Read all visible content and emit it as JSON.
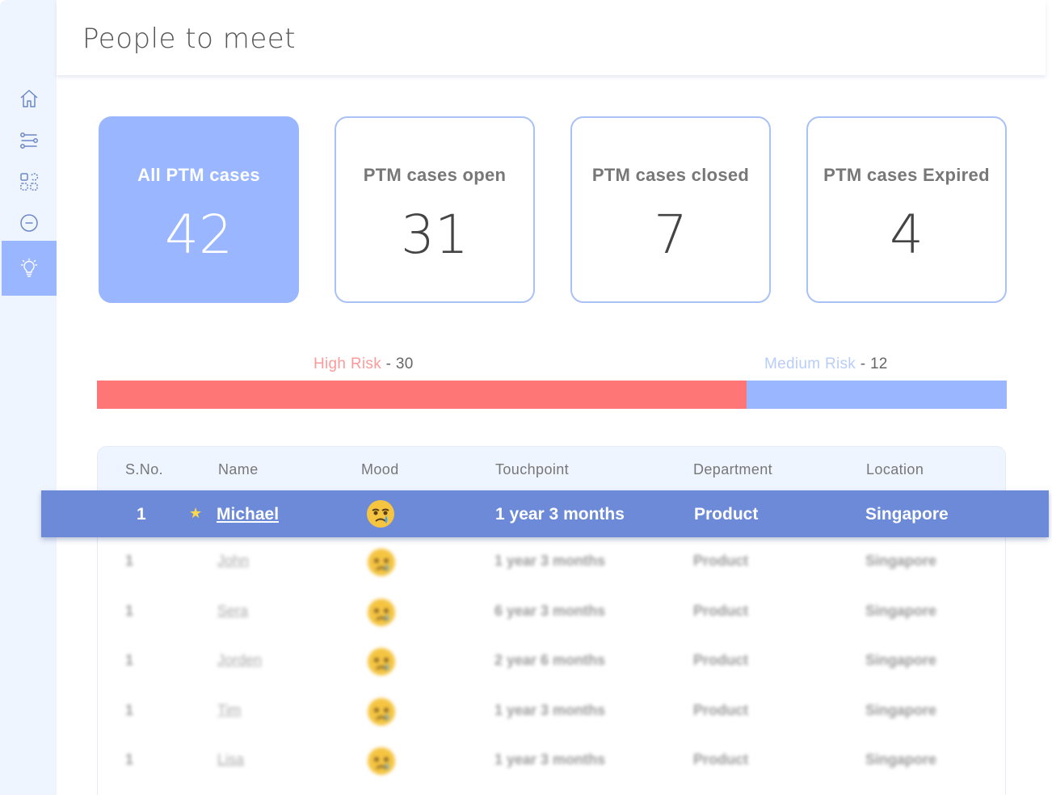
{
  "page": {
    "title": "People to meet"
  },
  "sidebar": {
    "items": [
      {
        "icon": "home-icon"
      },
      {
        "icon": "flow-icon"
      },
      {
        "icon": "grid-icon"
      },
      {
        "icon": "minus-circle-icon"
      },
      {
        "icon": "lightbulb-icon",
        "active": true
      }
    ]
  },
  "cards": [
    {
      "label": "All PTM cases",
      "value": "42"
    },
    {
      "label": "PTM cases open",
      "value": "31"
    },
    {
      "label": "PTM cases closed",
      "value": "7"
    },
    {
      "label": "PTM cases Expired",
      "value": "4"
    }
  ],
  "risk": {
    "high": {
      "label": "High Risk",
      "sep": "-",
      "count": "30",
      "color": "#ff7676",
      "value": 30
    },
    "medium": {
      "label": "Medium Risk",
      "sep": "-",
      "count": "12",
      "color": "#99b6ff",
      "value": 12
    }
  },
  "table": {
    "columns": [
      "S.No.",
      "Name",
      "Mood",
      "Touchpoint",
      "Department",
      "Location"
    ],
    "highlighted": {
      "sno": "1",
      "starred": true,
      "name": "Michael",
      "mood": "crying-face",
      "touchpoint": "1 year 3 months",
      "department": "Product",
      "location": "Singapore"
    },
    "rows": [
      {
        "sno": "1",
        "name": "John",
        "mood": "crying-face",
        "touchpoint": "1 year 3 months",
        "department": "Product",
        "location": "Singapore"
      },
      {
        "sno": "1",
        "name": "Sera",
        "mood": "crying-face",
        "touchpoint": "6 year 3 months",
        "department": "Product",
        "location": "Singapore"
      },
      {
        "sno": "1",
        "name": "Jorden",
        "mood": "crying-face",
        "touchpoint": "2 year 6 months",
        "department": "Product",
        "location": "Singapore"
      },
      {
        "sno": "1",
        "name": "Tim",
        "mood": "crying-face",
        "touchpoint": "1 year 3 months",
        "department": "Product",
        "location": "Singapore"
      },
      {
        "sno": "1",
        "name": "Lisa",
        "mood": "crying-face",
        "touchpoint": "1 year 3 months",
        "department": "Product",
        "location": "Singapore"
      }
    ]
  },
  "colors": {
    "accent": "#99b6ff",
    "highlight_row": "#6d8ad8",
    "sidebar_bg": "#eef5ff",
    "high_risk": "#ff7676"
  }
}
